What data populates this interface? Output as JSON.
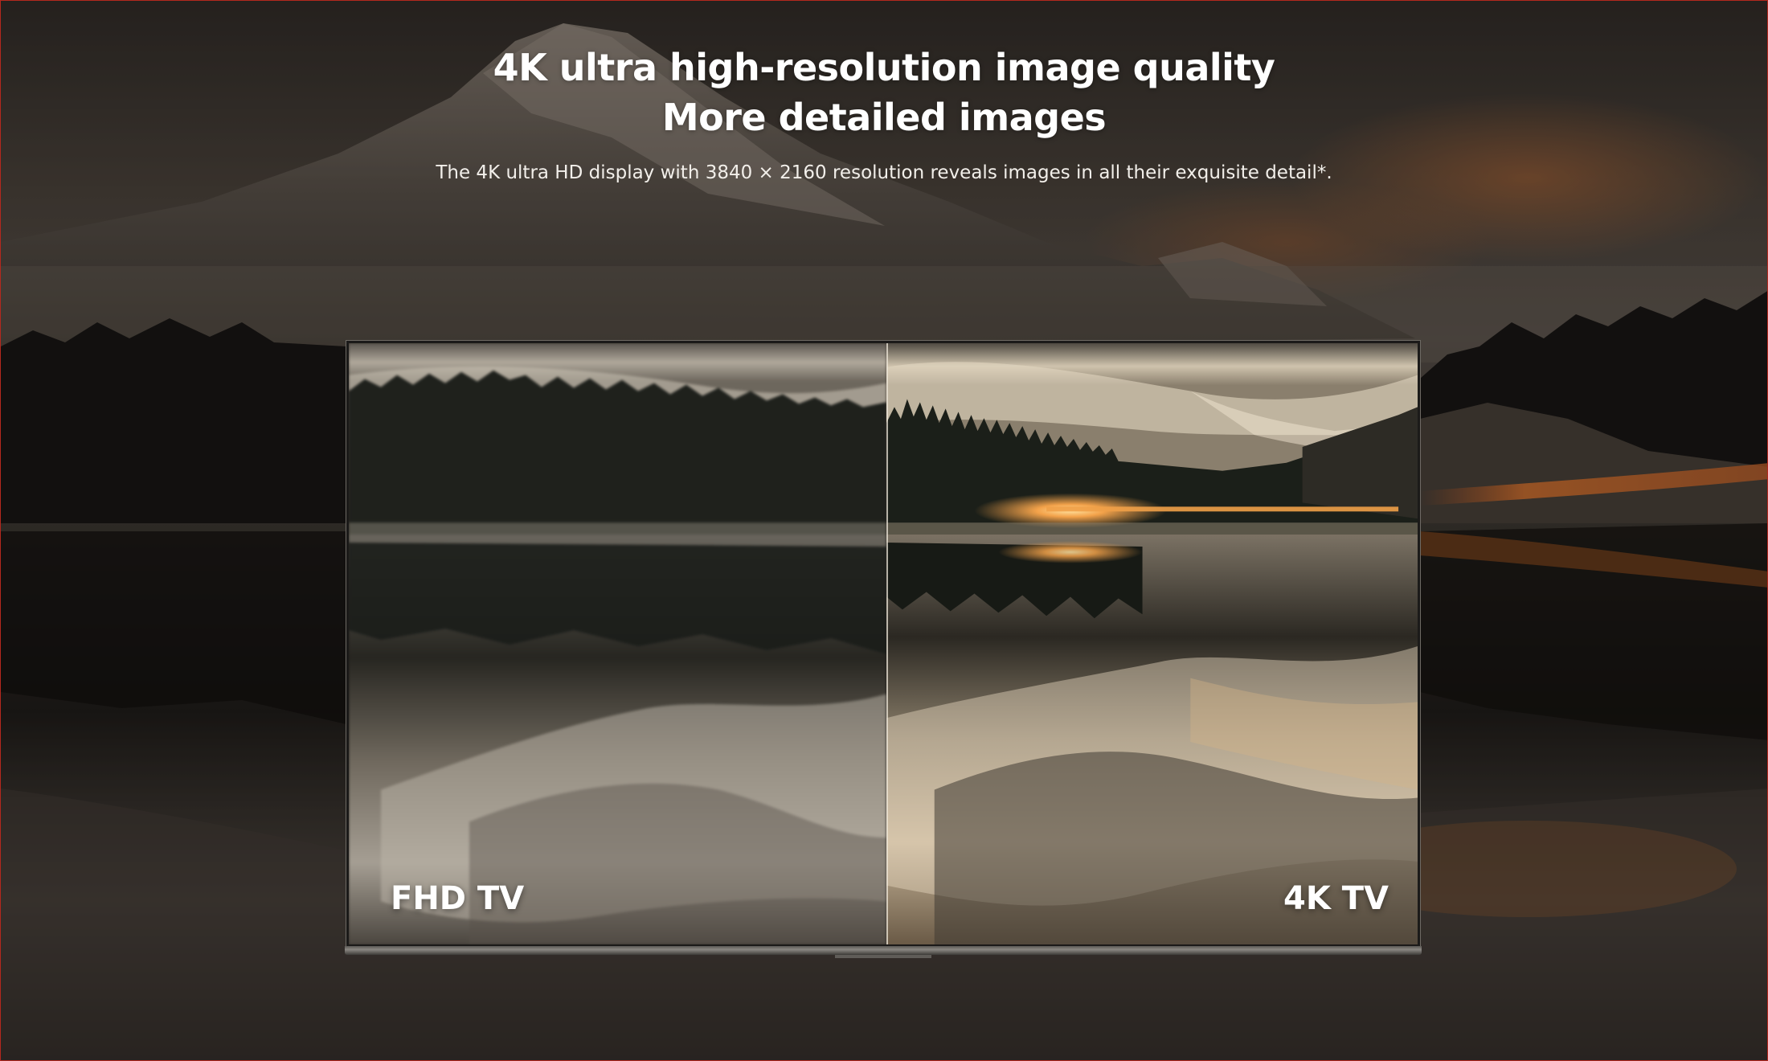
{
  "hero": {
    "headline_line1": "4K ultra high-resolution image quality",
    "headline_line2": "More detailed images",
    "subline": "The 4K ultra HD display with 3840 × 2160 resolution reveals images in all their exquisite detail*."
  },
  "comparison": {
    "left_label": "FHD TV",
    "right_label": "4K TV"
  },
  "colors": {
    "page_border": "#b4281e",
    "text": "#ffffff",
    "sunset_glow": "#f3a24a"
  }
}
